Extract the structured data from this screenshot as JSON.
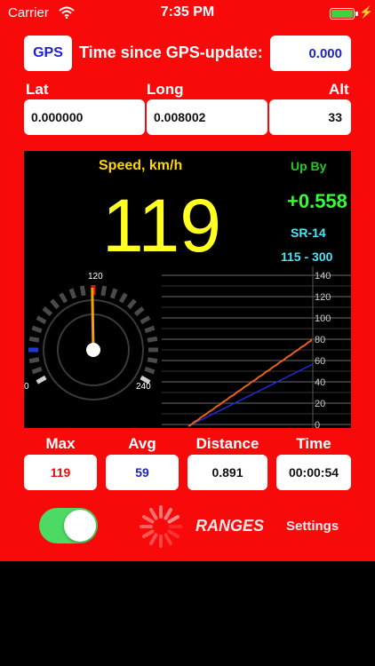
{
  "status_bar": {
    "carrier": "Carrier",
    "time": "7:35 PM"
  },
  "gps": {
    "button_label": "GPS",
    "label": "Time since GPS-update:",
    "value": "0.000"
  },
  "coords": {
    "lat_label": "Lat",
    "long_label": "Long",
    "alt_label": "Alt",
    "lat": "0.000000",
    "long": "0.008002",
    "alt": "33"
  },
  "dashboard": {
    "speed_title": "Speed, km/h",
    "speed_value": "119",
    "upby_label": "Up By",
    "upby_value": "+0.558",
    "range_name": "SR-14",
    "range_span": "115 - 300",
    "gauge": {
      "min_label": "0",
      "max_label": "240",
      "mark_label": "120",
      "speed": 119,
      "max": 240
    },
    "chart": {
      "axis_labels": [
        "140",
        "120",
        "100",
        "80",
        "60",
        "40",
        "20",
        "0"
      ]
    }
  },
  "stats": {
    "max_label": "Max",
    "avg_label": "Avg",
    "distance_label": "Distance",
    "time_label": "Time",
    "max": "119",
    "avg": "59",
    "distance": "0.891",
    "time": "00:00:54"
  },
  "controls": {
    "toggle_on": true,
    "ranges_label": "RANGES",
    "settings_label": "Settings"
  },
  "colors": {
    "background": "#f80a0a",
    "speed": "#ffff22",
    "upby": "#33ff33",
    "range": "#4ee6f2",
    "accent_blue": "#1d24c8",
    "stat_red": "#e01010"
  },
  "icons": [
    "wifi-icon",
    "battery-icon",
    "charging-bolt-icon",
    "loading-spinner-icon"
  ]
}
